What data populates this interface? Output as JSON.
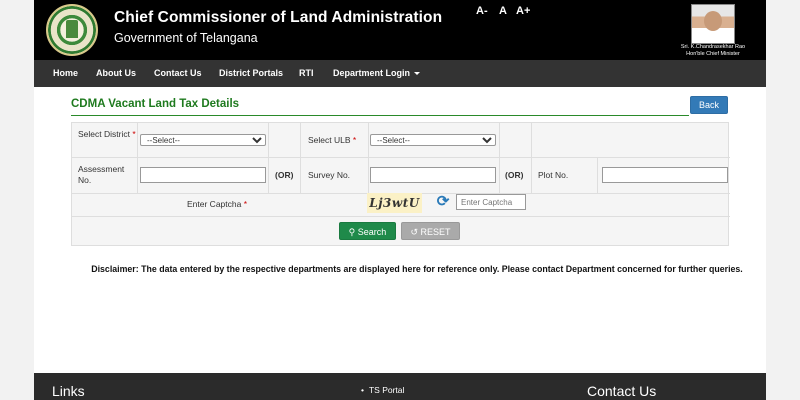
{
  "header": {
    "title": "Chief Commissioner of Land Administration",
    "subtitle": "Government of Telangana",
    "font_controls": [
      "A-",
      "A",
      "A+"
    ],
    "cm_name_line1": "Sri. K.Chandrasekhar Rao",
    "cm_name_line2": "Hon'ble Chief Minister"
  },
  "nav": {
    "items": [
      "Home",
      "About Us",
      "Contact Us",
      "District Portals",
      "RTI",
      "Department Login"
    ]
  },
  "section": {
    "title": "CDMA Vacant Land Tax Details",
    "back_label": "Back"
  },
  "form": {
    "select_district_label": "Select District",
    "select_district_value": "--Select--",
    "select_ulb_label": "Select ULB",
    "select_ulb_value": "--Select--",
    "assessment_label": "Assessment No.",
    "survey_label": "Survey No.",
    "plot_label": "Plot No.",
    "or_text": "(OR)",
    "captcha_label": "Enter Captcha",
    "required_mark": "*",
    "captcha_text": "Lj3wtU",
    "captcha_placeholder": "Enter Captcha",
    "search_label": "Search",
    "reset_label": "RESET"
  },
  "disclaimer": "Disclaimer: The data entered by the respective departments are displayed here for reference only. Please contact Department concerned for further queries.",
  "footer": {
    "links_heading": "Links",
    "ts_portal": "TS Portal",
    "contact_heading": "Contact Us"
  },
  "colors": {
    "title_green": "#1e7a1e",
    "back_blue": "#337ab7",
    "search_green": "#1f8a4a",
    "nav_bg": "#333333"
  }
}
